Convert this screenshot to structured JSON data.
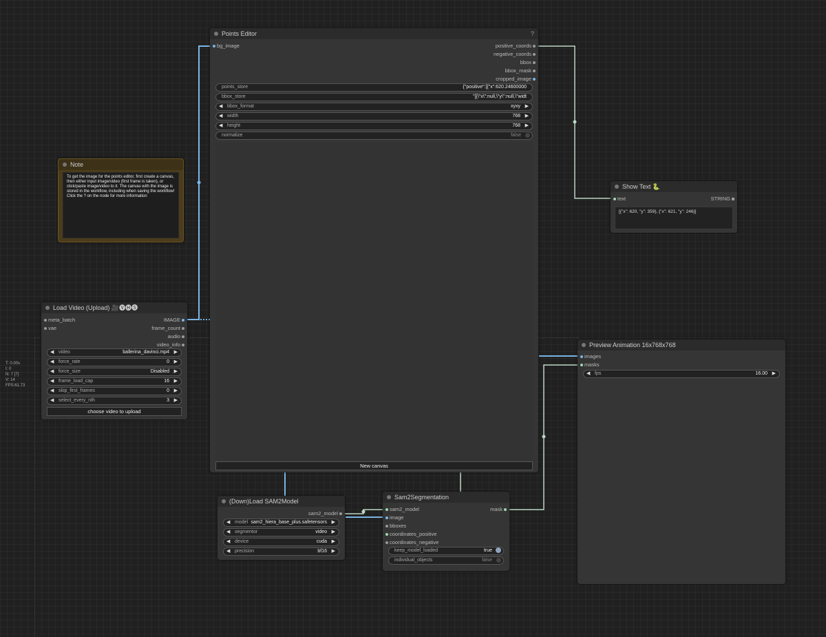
{
  "stats": {
    "lines": [
      "T: 0.00s",
      "I: 0",
      "N: 7 [7]",
      "V: 14",
      "FPS:61.73"
    ]
  },
  "note": {
    "title": "Note",
    "text": "To get the image for the points editor, first create a canvas, then either input image/video (first frame is taken), or click/paste image/video to it. The canvas with the image is stored in the workflow, including when saving the workflow! Click the ? on the node for more information"
  },
  "points_editor": {
    "title": "Points Editor",
    "help": "?",
    "input": "bg_image",
    "outputs": [
      "positive_coords",
      "negative_coords",
      "bbox",
      "bbox_mask",
      "cropped_image"
    ],
    "points_store": {
      "label": "points_store",
      "value": "{\"positive\":[{\"x\":620.24600000"
    },
    "bbox_store": {
      "label": "bbox_store",
      "value": "\"[{\\\"x\\\":null,\\\"y\\\":null,\\\"widt"
    },
    "bbox_format": {
      "label": "bbox_format",
      "value": "xyxy"
    },
    "width": {
      "label": "width",
      "value": "768"
    },
    "height": {
      "label": "height",
      "value": "768"
    },
    "normalize": {
      "label": "normalize",
      "value": "false"
    },
    "new_canvas": "New canvas"
  },
  "show_text": {
    "title": "Show Text 🐍",
    "input": "text",
    "output": "STRING",
    "content": "[{\"x\": 620, \"y\": 359}, {\"x\": 621, \"y\": 246}]"
  },
  "load_video": {
    "title": "Load Video (Upload) 🎥🅥🅗🅢",
    "inputs": [
      "meta_batch",
      "vae"
    ],
    "outputs": [
      "IMAGE",
      "frame_count",
      "audio",
      "video_info"
    ],
    "widgets": [
      {
        "label": "video",
        "value": "ballerina_davinci.mp4"
      },
      {
        "label": "force_rate",
        "value": "0"
      },
      {
        "label": "force_size",
        "value": "Disabled"
      },
      {
        "label": "frame_load_cap",
        "value": "16"
      },
      {
        "label": "skip_first_frames",
        "value": "0"
      },
      {
        "label": "select_every_nth",
        "value": "3"
      }
    ],
    "upload": "choose video to upload"
  },
  "preview": {
    "title": "Preview Animation 16x768x768",
    "inputs": [
      "images",
      "masks"
    ],
    "fps": {
      "label": "fps",
      "value": "16.00"
    }
  },
  "sam_model": {
    "title": "(Down)Load SAM2Model",
    "output": "sam2_model",
    "widgets": [
      {
        "label": "model",
        "value": "sam2_hiera_base_plus.safetensors"
      },
      {
        "label": "segmentor",
        "value": "video"
      },
      {
        "label": "device",
        "value": "cuda"
      },
      {
        "label": "precision",
        "value": "bf16"
      }
    ]
  },
  "segmentation": {
    "title": "Sam2Segmentation",
    "inputs": [
      "sam2_model",
      "image",
      "bboxes",
      "coordinates_positive",
      "coordinates_negative"
    ],
    "output": "mask",
    "keep_model_loaded": {
      "label": "keep_model_loaded",
      "value": "true"
    },
    "individual_objects": {
      "label": "individual_objects",
      "value": "false"
    }
  }
}
